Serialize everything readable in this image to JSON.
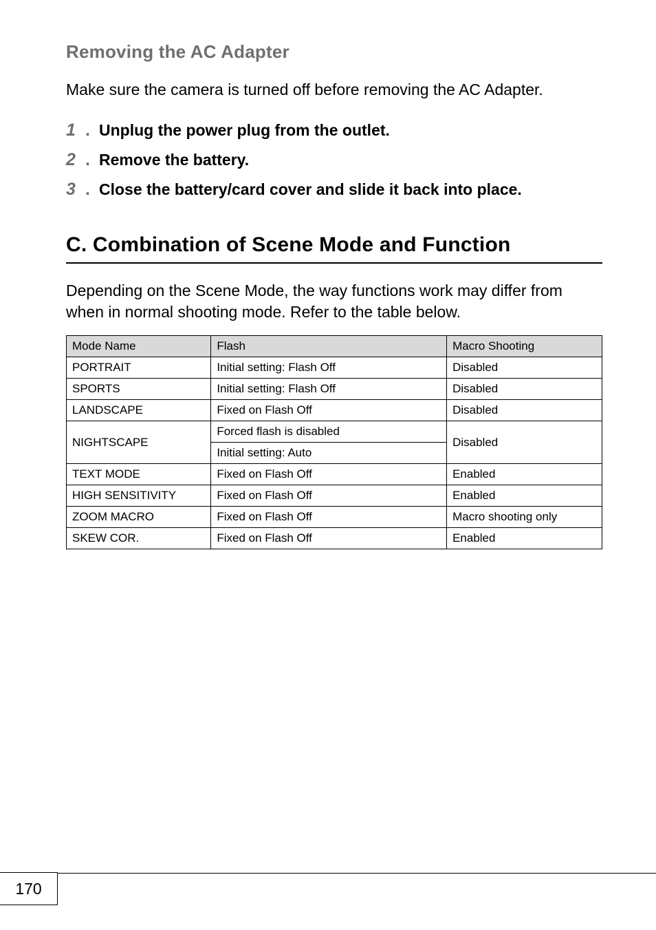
{
  "headings": {
    "sub": "Removing the AC Adapter",
    "section": "C. Combination of Scene Mode and Function"
  },
  "intro": "Make sure the camera is turned off before removing the AC Adapter.",
  "steps": [
    {
      "n": "1",
      "dot": ".",
      "text": "Unplug the power plug from the outlet."
    },
    {
      "n": "2",
      "dot": ".",
      "text": "Remove the battery."
    },
    {
      "n": "3",
      "dot": ".",
      "text": "Close the battery/card cover and slide it back into place."
    }
  ],
  "table_intro": "Depending on the Scene Mode, the way functions work may differ from when in normal shooting mode. Refer to the table below.",
  "table": {
    "headers": {
      "mode": "Mode Name",
      "flash": "Flash",
      "macro": "Macro Shooting"
    },
    "rows": [
      {
        "mode": "PORTRAIT",
        "flash": "Initial setting: Flash Off",
        "macro": "Disabled"
      },
      {
        "mode": "SPORTS",
        "flash": "Initial setting: Flash Off",
        "macro": "Disabled"
      },
      {
        "mode": "LANDSCAPE",
        "flash": "Fixed on Flash Off",
        "macro": "Disabled"
      },
      {
        "mode": "NIGHTSCAPE",
        "flash": "Forced flash is disabled",
        "flash2": "Initial setting: Auto",
        "macro": "Disabled"
      },
      {
        "mode": "TEXT MODE",
        "flash": "Fixed on Flash Off",
        "macro": "Enabled"
      },
      {
        "mode": "HIGH SENSITIVITY",
        "flash": "Fixed on Flash Off",
        "macro": "Enabled"
      },
      {
        "mode": "ZOOM MACRO",
        "flash": "Fixed on Flash Off",
        "macro": "Macro shooting only"
      },
      {
        "mode": "SKEW COR.",
        "flash": "Fixed on Flash Off",
        "macro": "Enabled"
      }
    ]
  },
  "page_number": "170"
}
